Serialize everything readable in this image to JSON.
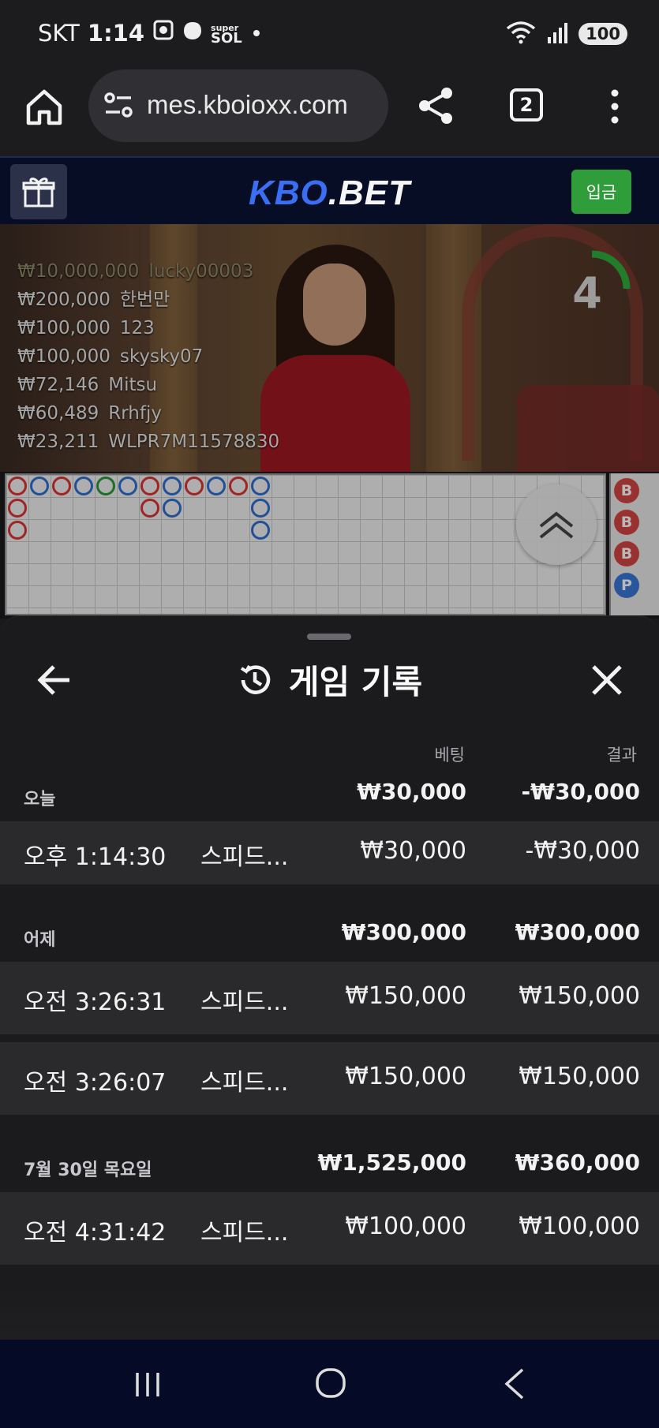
{
  "status_bar": {
    "carrier": "SKT",
    "time": "1:14",
    "network_badge": "super SOL",
    "battery": "100"
  },
  "browser": {
    "url": "mes.kboioxx.com",
    "tab_count": "2"
  },
  "site": {
    "logo_part1": "KBO",
    "logo_part2": ".BET",
    "deposit_label": "입금"
  },
  "live": {
    "timer": "4",
    "winners": [
      {
        "amount": "₩10,000,000",
        "name": "lucky00003"
      },
      {
        "amount": "₩200,000",
        "name": "한번만"
      },
      {
        "amount": "₩100,000",
        "name": "123"
      },
      {
        "amount": "₩100,000",
        "name": "skysky07"
      },
      {
        "amount": "₩72,146",
        "name": "Mitsu"
      },
      {
        "amount": "₩60,489",
        "name": "Rrhfjy"
      },
      {
        "amount": "₩23,211",
        "name": "WLPR7M11578830"
      }
    ],
    "side_road": [
      "B",
      "B",
      "B",
      "P"
    ]
  },
  "history": {
    "title": "게임 기록",
    "col_bet": "베팅",
    "col_result": "결과",
    "groups": [
      {
        "label": "오늘",
        "bet": "₩30,000",
        "result": "-₩30,000",
        "records": [
          {
            "time": "오후 1:14:30",
            "game": "스피드...",
            "bet": "₩30,000",
            "result": "-₩30,000"
          }
        ]
      },
      {
        "label": "어제",
        "bet": "₩300,000",
        "result": "₩300,000",
        "records": [
          {
            "time": "오전 3:26:31",
            "game": "스피드...",
            "bet": "₩150,000",
            "result": "₩150,000"
          },
          {
            "time": "오전 3:26:07",
            "game": "스피드...",
            "bet": "₩150,000",
            "result": "₩150,000"
          }
        ]
      },
      {
        "label": "7월 30일 목요일",
        "bet": "₩1,525,000",
        "result": "₩360,000",
        "records": [
          {
            "time": "오전 4:31:42",
            "game": "스피드...",
            "bet": "₩100,000",
            "result": "₩100,000"
          }
        ]
      }
    ]
  }
}
